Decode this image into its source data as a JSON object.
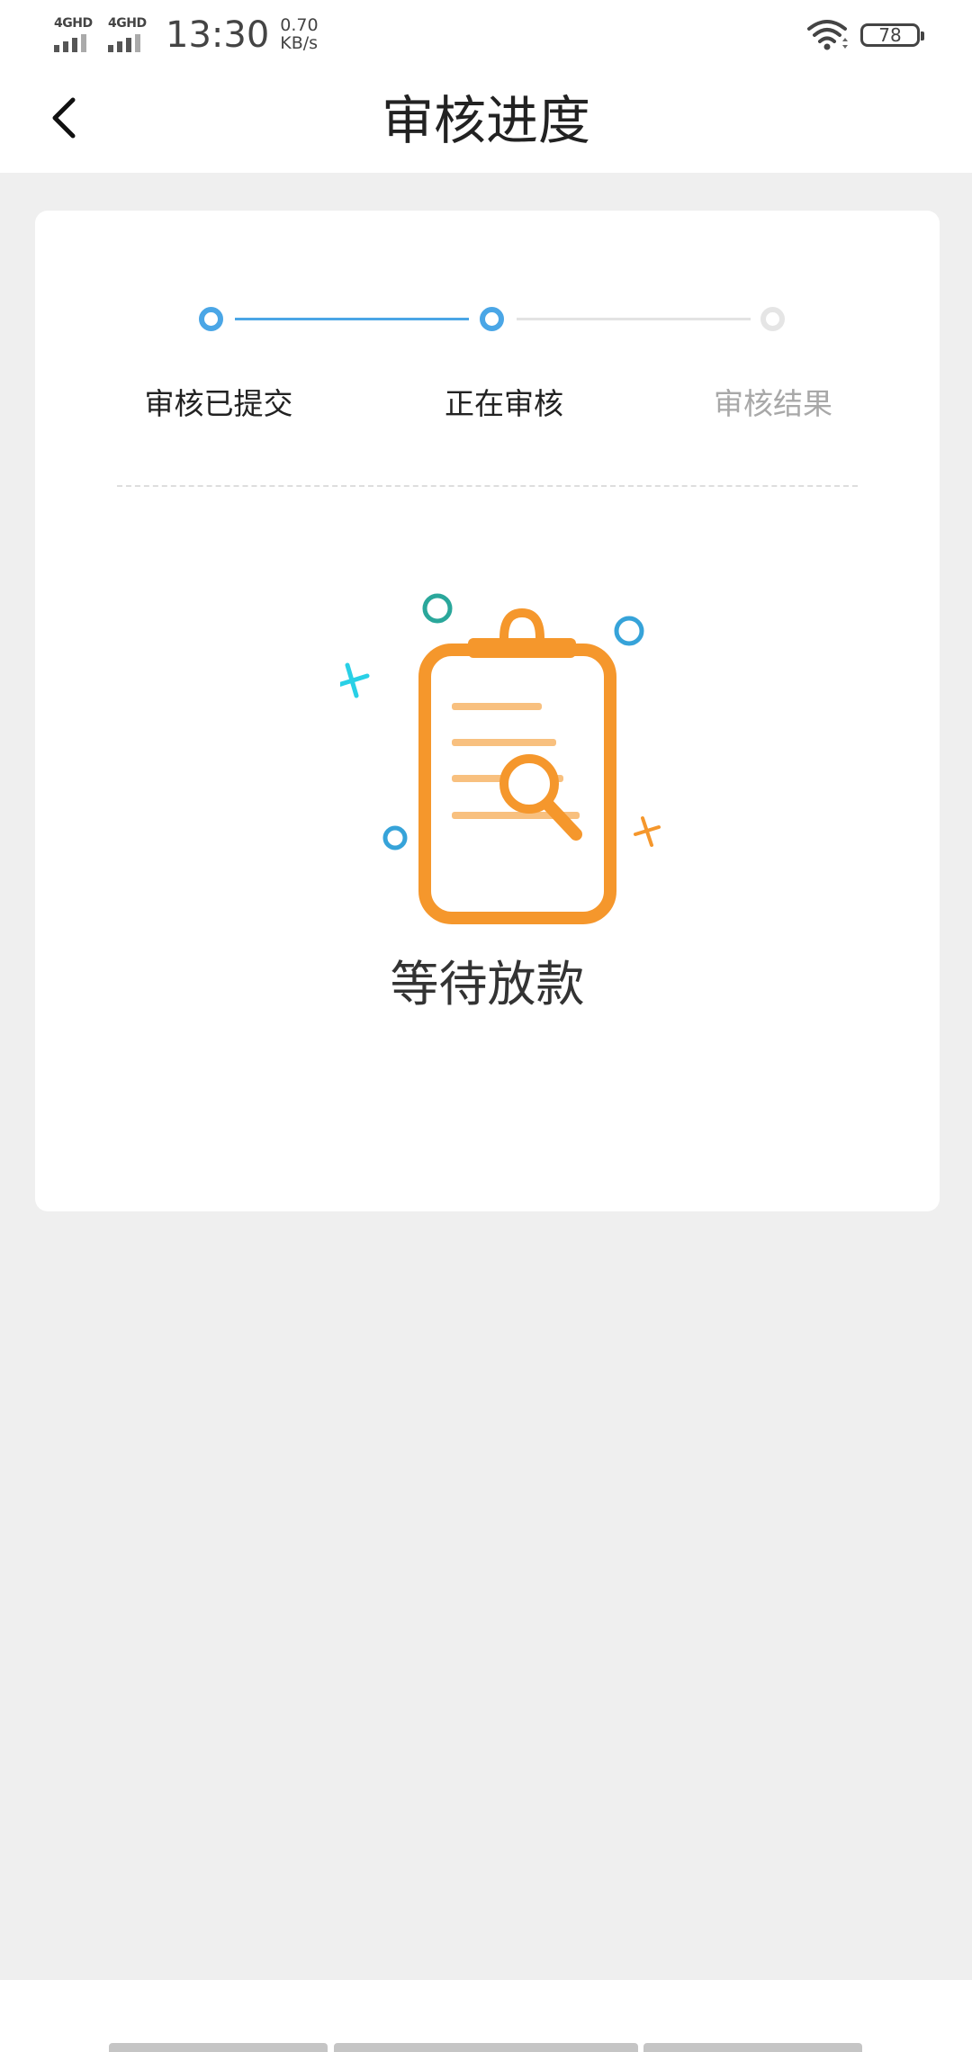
{
  "status_bar": {
    "network_1": "4GHD",
    "network_2": "4GHD",
    "time": "13:30",
    "speed_value": "0.70",
    "speed_unit": "KB/s",
    "battery": "78"
  },
  "header": {
    "title": "审核进度"
  },
  "progress": {
    "steps": [
      {
        "label": "审核已提交",
        "state": "active"
      },
      {
        "label": "正在审核",
        "state": "active"
      },
      {
        "label": "审核结果",
        "state": "inactive"
      }
    ],
    "active_color": "#4aa6e6",
    "inactive_color": "#e5e5e5"
  },
  "main": {
    "status_text": "等待放款",
    "illustration_icon": "clipboard-search-icon",
    "illustration_color": "#f5972c"
  }
}
